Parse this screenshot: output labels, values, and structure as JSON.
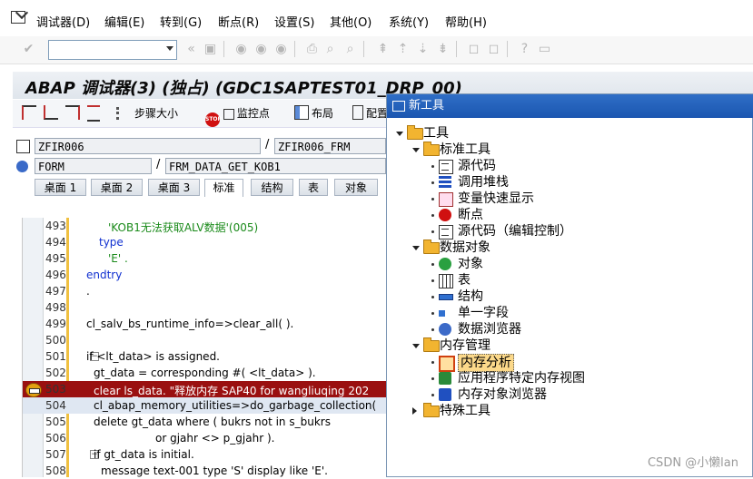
{
  "menubar": {
    "items": [
      "调试器(D)",
      "编辑(E)",
      "转到(G)",
      "断点(R)",
      "设置(S)",
      "其他(O)",
      "系统(Y)",
      "帮助(H)"
    ]
  },
  "toolbar": {
    "command_value": ""
  },
  "title": "ABAP 调试器(3) (独占) (GDC1SAPTEST01_DRP_00)",
  "app_toolbar": {
    "step_size": "步骤大小",
    "watchpoint": "监控点",
    "layout": "布局",
    "config": "配置"
  },
  "context": {
    "program": "ZFIR006",
    "include": "ZFIR006_FRM",
    "event_type": "FORM",
    "event_name": "FRM_DATA_GET_KOB1"
  },
  "tabs": [
    "桌面 1",
    "桌面 2",
    "桌面 3",
    "标准",
    "结构",
    "表",
    "对象"
  ],
  "active_tab": "标准",
  "code_lines": [
    {
      "n": "493",
      "t": "'KOB1无法获取ALV数据'(005)"
    },
    {
      "n": "494",
      "t": "type"
    },
    {
      "n": "495",
      "t": "'E' ."
    },
    {
      "n": "496",
      "t": "endtry"
    },
    {
      "n": "497",
      "t": "."
    },
    {
      "n": "498",
      "t": ""
    },
    {
      "n": "499",
      "t": "cl_salv_bs_runtime_info=>clear_all( )."
    },
    {
      "n": "500",
      "t": ""
    },
    {
      "n": "501",
      "t": "if <lt_data> is assigned."
    },
    {
      "n": "502",
      "t": "gt_data = corresponding #( <lt_data> )."
    },
    {
      "n": "503",
      "t": "clear ls_data. \"释放内存 SAP40 for wangliuqing 202"
    },
    {
      "n": "504",
      "t": "cl_abap_memory_utilities=>do_garbage_collection("
    },
    {
      "n": "505",
      "t": "delete gt_data where ( bukrs not in s_bukrs"
    },
    {
      "n": "506",
      "t": "or gjahr <> p_gjahr )."
    },
    {
      "n": "507",
      "t": "if gt_data is initial."
    },
    {
      "n": "508",
      "t": "message text-001 type 'S' display like 'E'."
    }
  ],
  "dock": {
    "title": "新工具",
    "tree": [
      {
        "label": "工具",
        "kind": "folder",
        "level": 0,
        "expanded": true
      },
      {
        "label": "标准工具",
        "kind": "folder",
        "level": 1,
        "expanded": true
      },
      {
        "label": "源代码",
        "kind": "src",
        "level": 2
      },
      {
        "label": "调用堆栈",
        "kind": "stack",
        "level": 2
      },
      {
        "label": "变量快速显示",
        "kind": "var",
        "level": 2
      },
      {
        "label": "断点",
        "kind": "stop",
        "level": 2
      },
      {
        "label": "源代码（编辑控制）",
        "kind": "src",
        "level": 2
      },
      {
        "label": "数据对象",
        "kind": "folder",
        "level": 1,
        "expanded": true
      },
      {
        "label": "对象",
        "kind": "obj",
        "level": 2
      },
      {
        "label": "表",
        "kind": "tbl",
        "level": 2
      },
      {
        "label": "结构",
        "kind": "struct",
        "level": 2
      },
      {
        "label": "单一字段",
        "kind": "field1",
        "level": 2
      },
      {
        "label": "数据浏览器",
        "kind": "browser",
        "level": 2
      },
      {
        "label": "内存管理",
        "kind": "folder",
        "level": 1,
        "expanded": true
      },
      {
        "label": "内存分析",
        "kind": "mem",
        "level": 2,
        "selected": true
      },
      {
        "label": "应用程序特定内存视图",
        "kind": "appmem",
        "level": 2
      },
      {
        "label": "内存对象浏览器",
        "kind": "memobj",
        "level": 2
      },
      {
        "label": "特殊工具",
        "kind": "folder",
        "level": 1,
        "expanded": false
      }
    ]
  },
  "watermark": "CSDN @小懒lan"
}
